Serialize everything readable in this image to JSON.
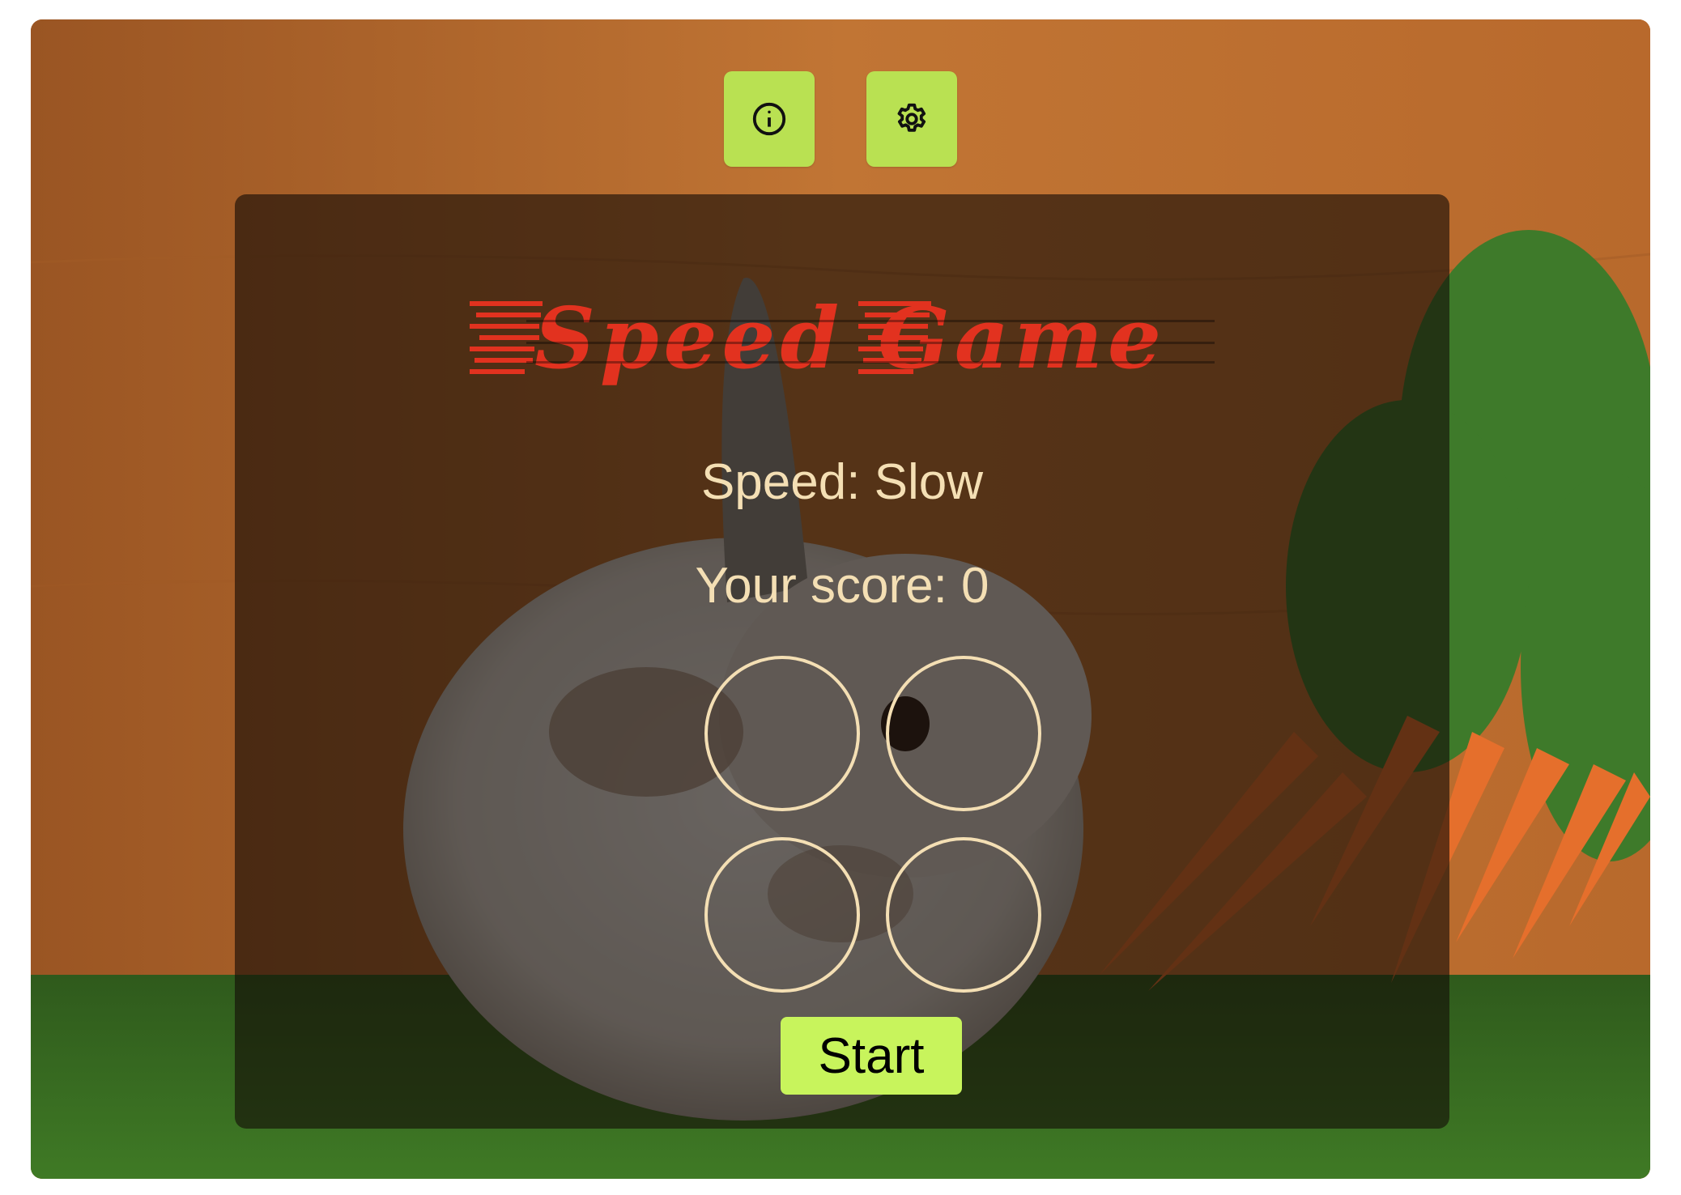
{
  "toolbar": {
    "info_icon": "info-circle-icon",
    "settings_icon": "gear-icon"
  },
  "game": {
    "title": "Speed Game",
    "speed_text": "Speed: Slow",
    "score_text": "Your score: 0",
    "circles": [
      "",
      "",
      "",
      ""
    ],
    "start_label": "Start"
  },
  "colors": {
    "button_green": "#b9e152",
    "start_green": "#c8f45c",
    "title_red": "#e2321f",
    "text_cream": "#f4dfb4",
    "panel_overlay": "rgba(20,12,6,0.62)"
  }
}
